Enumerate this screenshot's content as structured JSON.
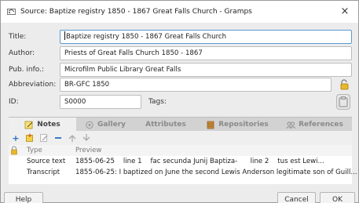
{
  "window": {
    "title": "Source: Baptize registry 1850 - 1867 Great Falls Church - Gramps",
    "close_glyph": "×"
  },
  "form": {
    "title_label": "Title:",
    "title_value": "Baptize registry 1850 - 1867 Great Falls Church",
    "author_label": "Author:",
    "author_value": "Priests of Great Falls Church 1850 - 1867",
    "pubinfo_label": "Pub. info.:",
    "pubinfo_value": "Microfilm Public Library Great Falls",
    "abbrev_label": "Abbreviation:",
    "abbrev_value": "BR-GFC 1850",
    "id_label": "ID:",
    "id_value": "S0000",
    "tags_label": "Tags:"
  },
  "tabs": [
    {
      "label": "Notes",
      "icon": "note-icon",
      "active": true
    },
    {
      "label": "Gallery",
      "icon": "gallery-icon",
      "active": false
    },
    {
      "label": "Attributes",
      "icon": "",
      "active": false
    },
    {
      "label": "Repositories",
      "icon": "repository-icon",
      "active": false
    },
    {
      "label": "References",
      "icon": "references-icon",
      "active": false
    }
  ],
  "toolbar": {
    "add": "add-icon",
    "share": "share-existing-icon",
    "edit": "edit-icon",
    "remove": "remove-icon",
    "up": "move-up-icon",
    "down": "move-down-icon"
  },
  "list": {
    "headers": [
      "Type",
      "Preview"
    ],
    "rows": [
      {
        "type": "Source text",
        "preview": "1855-06-25    line 1    fac secunda Junij Baptiza-      line 2    tus est Lewi..."
      },
      {
        "type": "Transcript",
        "preview": "1855-06-25: I baptized on June the second Lewis Anderson legitimate son of Guill..."
      }
    ]
  },
  "buttons": {
    "help": "Help",
    "cancel": "Cancel",
    "ok": "OK"
  },
  "colors": {
    "accent_blue": "#5b9bd5",
    "add_blue": "#2a6fc7",
    "lock_gold": "#d4a017"
  }
}
